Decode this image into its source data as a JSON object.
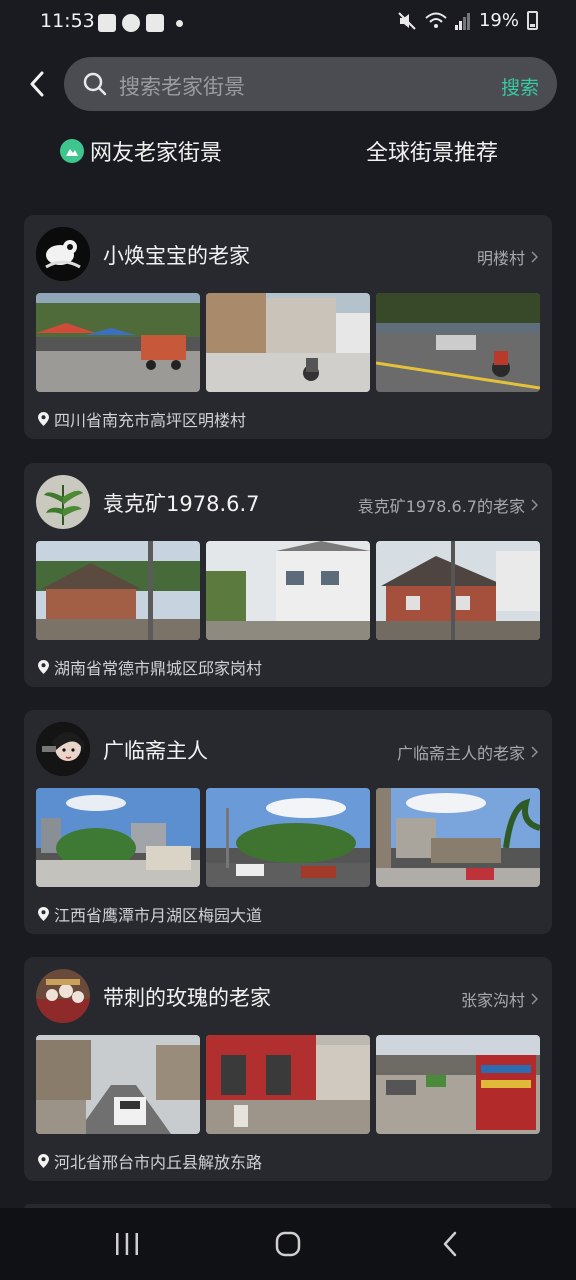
{
  "status": {
    "time": "11:53",
    "battery": "19%",
    "icons": [
      "gallery-icon",
      "cloud-icon",
      "check-icon",
      "dot-icon",
      "mute-icon",
      "wifi-icon",
      "signal-icon",
      "battery-icon"
    ]
  },
  "search": {
    "placeholder": "搜索老家街景",
    "submit_label": "搜索"
  },
  "tabs": [
    {
      "label": "网友老家街景",
      "active": true
    },
    {
      "label": "全球街景推荐",
      "active": false
    }
  ],
  "cards": [
    {
      "username": "小焕宝宝的老家",
      "link": "明楼村",
      "location": "四川省南充市高坪区明楼村"
    },
    {
      "username": "袁克矿1978.6.7",
      "link": "袁克矿1978.6.7的老家",
      "location": "湖南省常德市鼎城区邱家岗村"
    },
    {
      "username": "广临斋主人",
      "link": "广临斋主人的老家",
      "location": "江西省鹰潭市月湖区梅园大道"
    },
    {
      "username": "带刺的玫瑰的老家",
      "link": "张家沟村",
      "location": "河北省邢台市内丘县解放东路"
    }
  ],
  "colors": {
    "background": "#191b21",
    "card": "#27292f",
    "accent": "#38c8a2",
    "search_box": "#4a4c52"
  },
  "nav": [
    "recent-apps-icon",
    "home-icon",
    "back-icon"
  ]
}
